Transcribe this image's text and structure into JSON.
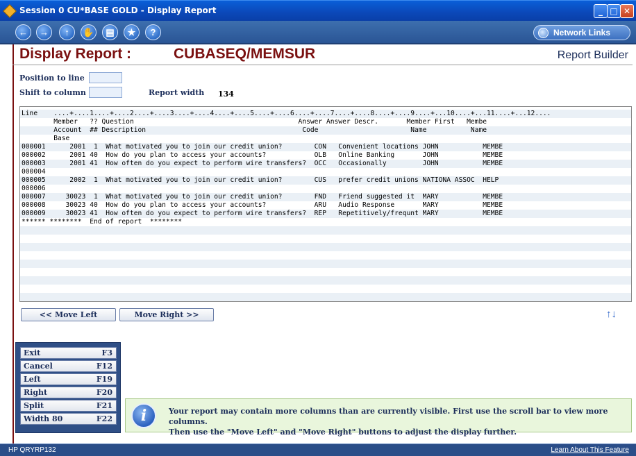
{
  "window": {
    "title": "Session 0 CU*BASE GOLD - Display Report"
  },
  "toolbar": {
    "network_links": "Network Links"
  },
  "header": {
    "title": "Display Report :",
    "subtitle": "CUBASEQ/MEMSUR",
    "right_label": "Report Builder"
  },
  "position": {
    "line_label": "Position to line",
    "shift_label": "Shift to column",
    "width_label": "Report width",
    "width_value": "134"
  },
  "report": {
    "lines": [
      "Line    ....+....1....+....2....+....3....+....4....+....5....+....6....+....7....+....8....+....9....+...10....+...11....+...12....",
      "        Member   ?? Question                                         Answer Answer Descr.       Member First   Membe",
      "        Account  ## Description                                       Code                       Name           Name",
      "        Base",
      "000001      2001  1  What motivated you to join our credit union?        CON   Convenient locations JOHN           MEMBE",
      "000002      2001 40  How do you plan to access your accounts?            OLB   Online Banking       JOHN           MEMBE",
      "000003      2001 41  How often do you expect to perform wire transfers?  OCC   Occasionally         JOHN           MEMBE",
      "000004",
      "000005      2002  1  What motivated you to join our credit union?        CUS   prefer credit unions NATIONA ASSOC  HELP",
      "000006",
      "000007     30023  1  What motivated you to join our credit union?        FND   Friend suggested it  MARY           MEMBE",
      "000008     30023 40  How do you plan to access your accounts?            ARU   Audio Response       MARY           MEMBE",
      "000009     30023 41  How often do you expect to perform wire transfers?  REP   Repetitively/frequnt MARY           MEMBE",
      "****** ********  End of report  ********"
    ]
  },
  "move": {
    "left": "<< Move Left",
    "right": "Move Right >>"
  },
  "fkeys": [
    {
      "label": "Exit",
      "key": "F3"
    },
    {
      "label": "Cancel",
      "key": "F12"
    },
    {
      "label": "Left",
      "key": "F19"
    },
    {
      "label": "Right",
      "key": "F20"
    },
    {
      "label": "Split",
      "key": "F21"
    },
    {
      "label": "Width 80",
      "key": "F22"
    }
  ],
  "info": {
    "line1": "Your report may contain more columns than are currently visible.  First use the scroll bar to view more columns.",
    "line2": "Then use the \"Move Left\" and \"Move Right\" buttons to adjust the display further."
  },
  "status": {
    "left": "HP QRYRP132",
    "right": "Learn About This Feature"
  }
}
